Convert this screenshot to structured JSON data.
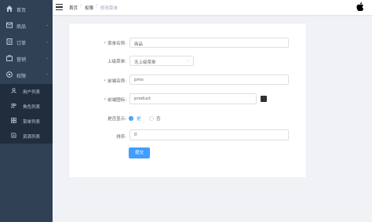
{
  "sidebar": {
    "items": [
      {
        "label": "首页",
        "icon": "home-icon",
        "has_arrow": false
      },
      {
        "label": "商品",
        "icon": "product-icon",
        "has_arrow": true
      },
      {
        "label": "订单",
        "icon": "order-icon",
        "has_arrow": true
      },
      {
        "label": "营销",
        "icon": "marketing-icon",
        "has_arrow": true
      },
      {
        "label": "权限",
        "icon": "permission-icon",
        "has_arrow": true
      }
    ],
    "submenu": [
      {
        "label": "用户列表",
        "icon": "user-icon"
      },
      {
        "label": "角色列表",
        "icon": "role-icon"
      },
      {
        "label": "菜单列表",
        "icon": "menu-icon"
      },
      {
        "label": "资源列表",
        "icon": "resource-icon"
      }
    ],
    "arrow_glyph": "⌄"
  },
  "header": {
    "breadcrumb": [
      "首页",
      "权限",
      "修改菜单"
    ],
    "separator": "/"
  },
  "form": {
    "title_label": "菜单名称:",
    "title_value": "商品",
    "parent_label": "上级菜单:",
    "parent_value": "无上级菜单",
    "frontname_label": "前端名称:",
    "frontname_value": "pms",
    "fronticon_label": "前端图标:",
    "fronticon_value": "product",
    "show_label": "是否显示:",
    "show_yes": "是",
    "show_no": "否",
    "show_selected": "是",
    "sort_label": "排序:",
    "sort_value": "0",
    "submit_label": "提交"
  },
  "colors": {
    "sidebar_bg": "#304156",
    "submenu_bg": "#1f2d3d",
    "primary": "#409eff",
    "required": "#f56c6c"
  }
}
